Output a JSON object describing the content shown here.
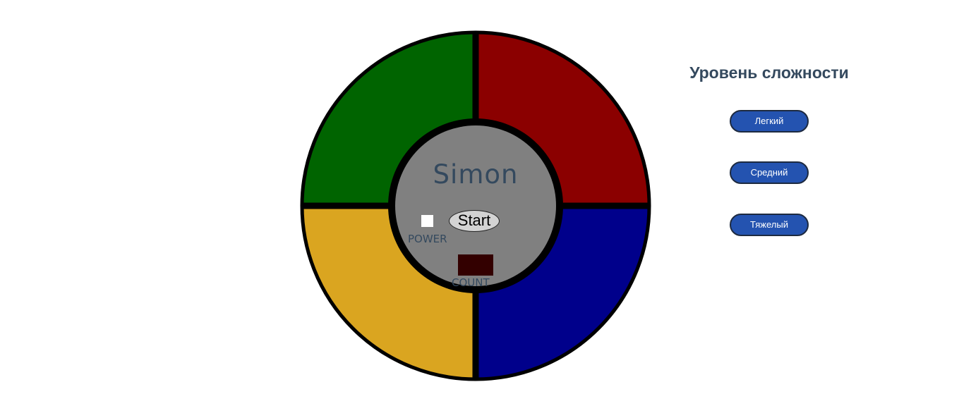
{
  "game": {
    "title": "Simon",
    "start_label": "Start",
    "power_label": "POWER",
    "count_label": "COUNT",
    "count_value": ""
  },
  "pads": [
    {
      "name": "green",
      "color": "#006400"
    },
    {
      "name": "red",
      "color": "#8b0000"
    },
    {
      "name": "yellow",
      "color": "#daa520"
    },
    {
      "name": "blue",
      "color": "#00008b"
    }
  ],
  "difficulty": {
    "title": "Уровень сложности",
    "levels": [
      {
        "label": "Легкий"
      },
      {
        "label": "Средний"
      },
      {
        "label": "Тяжелый"
      }
    ]
  }
}
